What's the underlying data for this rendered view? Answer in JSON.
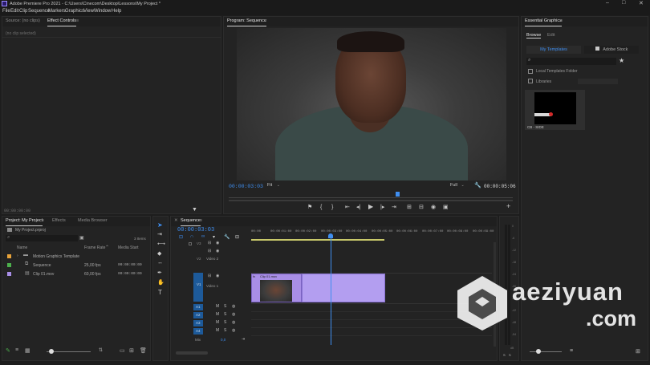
{
  "titlebar": {
    "title": "Adobe Premiere Pro 2021 - C:\\Users\\Cinecom\\Desktop\\Lessons\\My Project *",
    "min": "–",
    "max": "□",
    "close": "✕"
  },
  "menu": [
    "File",
    "Edit",
    "Clip",
    "Sequence",
    "Markers",
    "Graphics",
    "View",
    "Window",
    "Help"
  ],
  "effects_panel": {
    "tab1": "Source: (no clips)",
    "tab2": "Effect Controls",
    "message": "(no clip selected)",
    "timecode": "00:00:00:00"
  },
  "program": {
    "tab": "Program: Sequence",
    "timecode": "00:00:03:03",
    "fit": "Fit",
    "quality": "Full",
    "duration": "00:00:05:06"
  },
  "essential_graphics": {
    "tab": "Essential Graphics",
    "browse": "Browse",
    "edit": "Edit",
    "my_templates": "My Templates",
    "adobe_stock": "Adobe Stock",
    "local_folder": "Local Templates Folder",
    "libraries": "Libraries",
    "template_label": "CB - SIDE"
  },
  "project": {
    "tab": "Project: My Project",
    "tab2": "Effects",
    "tab3": "Media Browser",
    "name": "My Project.prproj",
    "items_count": "3 Items",
    "headers": [
      "Name",
      "Frame Rate",
      "Media Start"
    ],
    "rows": [
      {
        "color": "#e8a33a",
        "name": "Motion Graphics Template",
        "rate": "",
        "start": ""
      },
      {
        "color": "#4cb04c",
        "name": "Sequence",
        "rate": "25,00 fps",
        "start": "00:00:00:00"
      },
      {
        "color": "#a88ee6",
        "name": "Clip 01.mov",
        "rate": "60,00 fps",
        "start": "00:00:00:00"
      }
    ]
  },
  "sequence": {
    "tab": "Sequence",
    "timecode": "00:00:03:03",
    "ruler": [
      "00:00",
      "00:00:01:00",
      "00:00:02:00",
      "00:00:03:00",
      "00:00:04:00",
      "00:00:05:00",
      "00:00:06:00",
      "00:00:07:00",
      "00:00:08:00",
      "00:00:09:00"
    ],
    "video_tracks": [
      {
        "id": "V3",
        "name": ""
      },
      {
        "id": "V2",
        "name": "Video 2"
      },
      {
        "id": "V1",
        "name": "Video 1"
      }
    ],
    "audio_tracks": [
      "A1",
      "A2",
      "A3",
      "A4"
    ],
    "mix_label": "Mix",
    "mix_value": "0,0",
    "clip_label": "Clip 01.mov"
  },
  "watermark": {
    "line1": "aeziyuan",
    "line2": ".com"
  },
  "meter_labels": [
    "0",
    "-6",
    "-12",
    "-18",
    "-24",
    "-30",
    "-36",
    "-42",
    "-48",
    "-54",
    "dB"
  ]
}
